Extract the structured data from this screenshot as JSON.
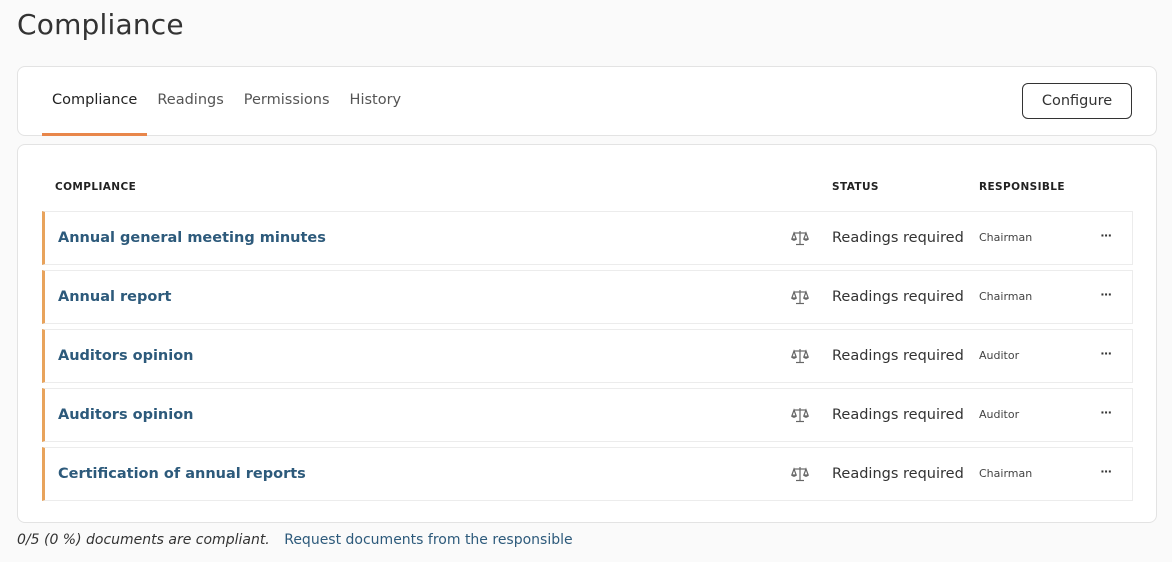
{
  "page": {
    "title": "Compliance"
  },
  "tabs": [
    {
      "label": "Compliance",
      "active": true
    },
    {
      "label": "Readings",
      "active": false
    },
    {
      "label": "Permissions",
      "active": false
    },
    {
      "label": "History",
      "active": false
    }
  ],
  "toolbar": {
    "configure_label": "Configure"
  },
  "table": {
    "headers": {
      "compliance": "COMPLIANCE",
      "status": "STATUS",
      "responsible": "RESPONSIBLE"
    },
    "rows": [
      {
        "title": "Annual general meeting minutes",
        "icon": "scale-icon",
        "status": "Readings required",
        "responsible": "Chairman",
        "menu": "···"
      },
      {
        "title": "Annual report",
        "icon": "scale-icon",
        "status": "Readings required",
        "responsible": "Chairman",
        "menu": "···"
      },
      {
        "title": "Auditors opinion",
        "icon": "scale-icon",
        "status": "Readings required",
        "responsible": "Auditor",
        "menu": "···"
      },
      {
        "title": "Auditors opinion",
        "icon": "scale-icon",
        "status": "Readings required",
        "responsible": "Auditor",
        "menu": "···"
      },
      {
        "title": "Certification of annual reports",
        "icon": "scale-icon",
        "status": "Readings required",
        "responsible": "Chairman",
        "menu": "···"
      }
    ]
  },
  "footer": {
    "summary": "0/5 (0 %) documents are compliant.",
    "link": "Request documents from the responsible"
  },
  "colors": {
    "accent": "#e8864a",
    "row_border": "#e8a35c",
    "link": "#2d5a7b"
  }
}
